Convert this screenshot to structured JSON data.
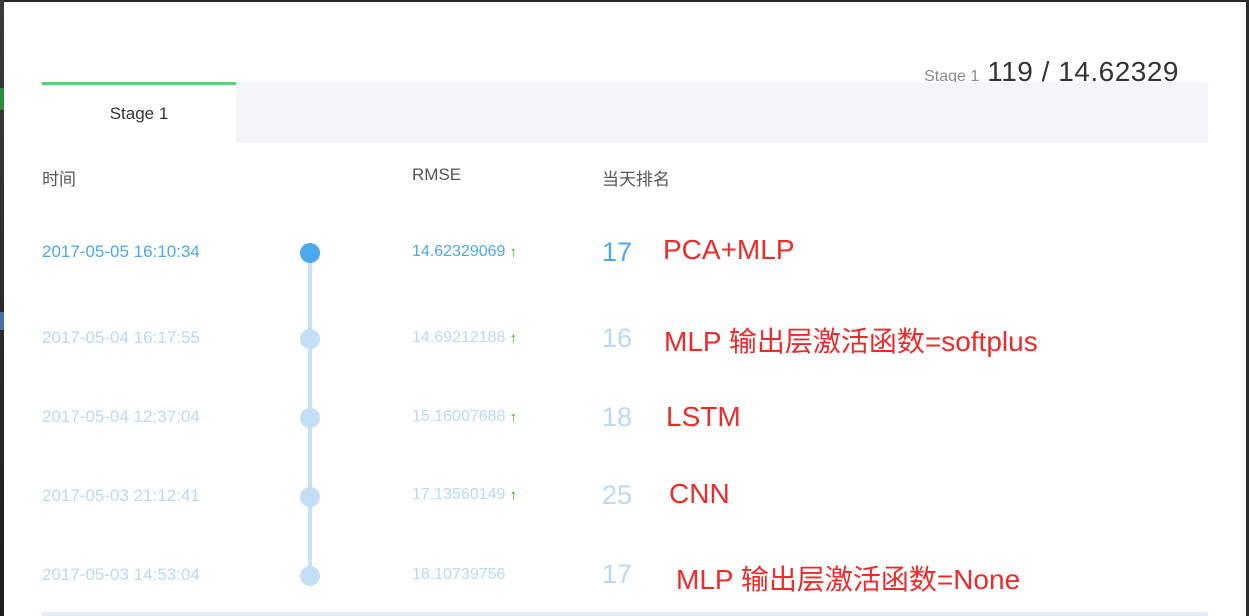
{
  "score": {
    "stage_label": "Stage 1",
    "value": "119 / 14.62329"
  },
  "tabs": [
    {
      "label": "Stage 1"
    }
  ],
  "columns": {
    "time": "时间",
    "rmse": "RMSE",
    "rank": "当天排名"
  },
  "rows": [
    {
      "time": "2017-05-05 16:10:34",
      "rmse": "14.62329069",
      "improved": true,
      "rank": "17",
      "note": "PCA+MLP"
    },
    {
      "time": "2017-05-04 16:17:55",
      "rmse": "14.69212188",
      "improved": true,
      "rank": "16",
      "note": "MLP 输出层激活函数=softplus"
    },
    {
      "time": "2017-05-04 12:37:04",
      "rmse": "15.16007688",
      "improved": true,
      "rank": "18",
      "note": "LSTM"
    },
    {
      "time": "2017-05-03 21:12:41",
      "rmse": "17.13560149",
      "improved": true,
      "rank": "25",
      "note": "CNN"
    },
    {
      "time": "2017-05-03 14:53:04",
      "rmse": "18.10739756",
      "improved": false,
      "rank": "17",
      "note": "MLP 输出层激活函数=None"
    }
  ],
  "icons": {
    "improvement": "up-arrow-icon",
    "timeline": "timeline-dot-icon"
  },
  "colors": {
    "accent": "#4aa8ec",
    "faded": "#b9daf2",
    "tab_indicator": "#5fcf73",
    "improvement": "#27b400",
    "annotation": "#ee2b2b"
  }
}
